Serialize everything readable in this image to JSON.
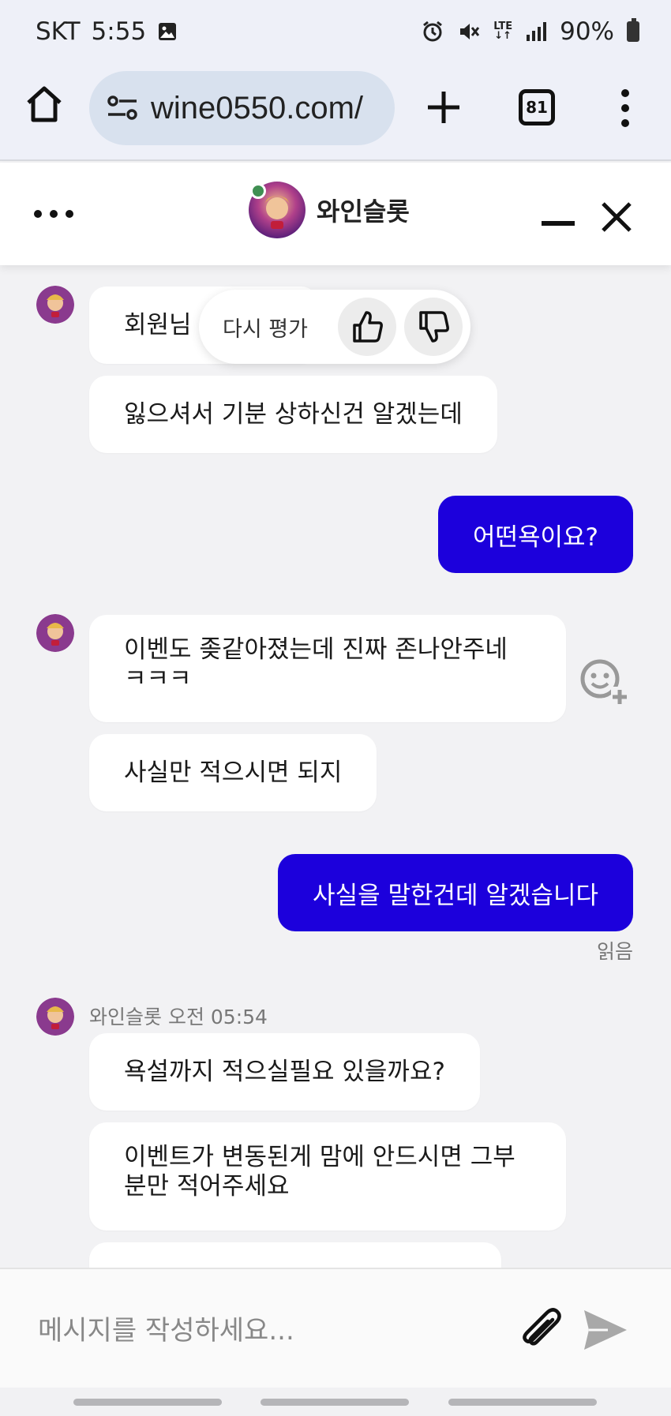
{
  "status_bar": {
    "carrier": "SKT",
    "time": "5:55",
    "network": "LTE",
    "battery": "90%",
    "icons": [
      "image-icon",
      "alarm-icon",
      "mute-icon",
      "lte-icon",
      "signal-icon",
      "battery-icon"
    ]
  },
  "browser": {
    "url": "wine0550.com/",
    "tab_count": "81",
    "icons": [
      "home-icon",
      "site-settings-icon",
      "plus-icon",
      "tabs-icon",
      "more-vert-icon"
    ]
  },
  "chat_header": {
    "title": "와인슬롯",
    "online": true
  },
  "rating_popup": {
    "label": "다시 평가",
    "icons": [
      "thumbs-up-icon",
      "thumbs-down-icon"
    ]
  },
  "messages": [
    {
      "from": "bot",
      "text": "회원님"
    },
    {
      "from": "bot",
      "text": "잃으셔서 기분 상하신건 알겠는데"
    },
    {
      "from": "user",
      "text": "어떤욕이요?"
    },
    {
      "from": "bot",
      "text": "이벤도 좆같아졌는데 진짜 존나안주네\nㅋㅋㅋ"
    },
    {
      "from": "bot",
      "text": "사실만 적으시면 되지"
    },
    {
      "from": "user",
      "text": "사실을 말한건데 알겠습니다"
    },
    {
      "from": "bot",
      "text": "욕설까지 적으실필요 있을까요?"
    },
    {
      "from": "bot",
      "text": "이벤트가 변동된게 맘에 안드시면 그부\n분만 적어주세요"
    }
  ],
  "read_receipt": "읽음",
  "bot_meta": "와인슬롯 오전 05:54",
  "composer": {
    "placeholder": "메시지를 작성하세요..."
  },
  "colors": {
    "user_bubble": "#1c00dc",
    "bot_bubble": "#ffffff",
    "chat_bg": "#f2f2f4",
    "online_dot": "#3f8f52"
  }
}
